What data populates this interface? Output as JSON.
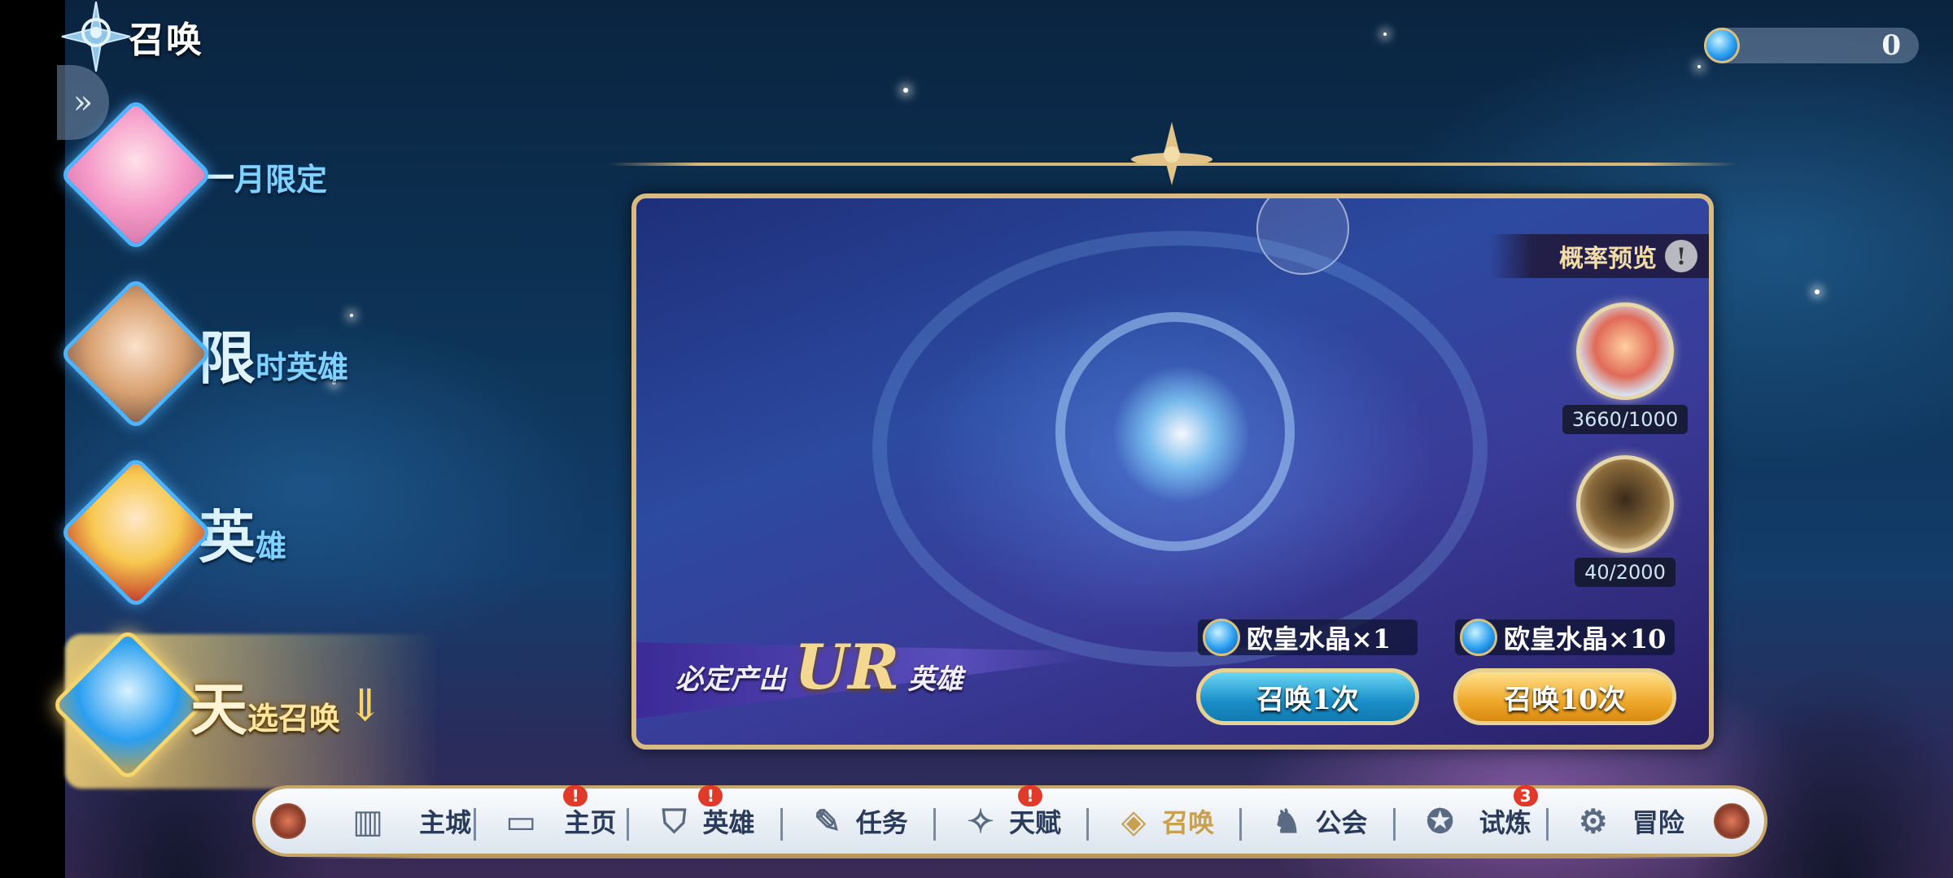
{
  "header": {
    "title": "召唤"
  },
  "currency": {
    "value": "0",
    "icon": "blue-crystal-gem"
  },
  "banners": [
    {
      "big": "一",
      "small": "月限定",
      "active": false
    },
    {
      "big": "限",
      "small": "时英雄",
      "active": false
    },
    {
      "big": "英",
      "small": "雄",
      "active": false
    },
    {
      "big": "天",
      "small": "选召唤",
      "active": true
    }
  ],
  "panel": {
    "probability_label": "概率预览",
    "rewards": [
      {
        "progress": "3660/1000",
        "icon": "treasure-chest"
      },
      {
        "progress": "40/2000",
        "icon": "hero-silhouette"
      }
    ],
    "ur": {
      "prefix": "必定产出",
      "highlight": "UR",
      "suffix": "英雄"
    },
    "summons": [
      {
        "cost": "欧皇水晶×1",
        "button": "召唤1次",
        "color": "#1a8ec8"
      },
      {
        "cost": "欧皇水晶×10",
        "button": "召唤10次",
        "color": "#f0a82a"
      }
    ]
  },
  "nav": {
    "items": [
      {
        "label": "主城",
        "icon": "castle-gate",
        "badge": ""
      },
      {
        "label": "主页",
        "icon": "banner-frame",
        "badge": "!"
      },
      {
        "label": "英雄",
        "icon": "helmet",
        "badge": "!"
      },
      {
        "label": "任务",
        "icon": "scroll-feather",
        "badge": ""
      },
      {
        "label": "天赋",
        "icon": "talent-star",
        "badge": "!"
      },
      {
        "label": "召唤",
        "icon": "summon-diamond",
        "badge": ""
      },
      {
        "label": "公会",
        "icon": "guild-knight",
        "badge": ""
      },
      {
        "label": "试炼",
        "icon": "trial-crest",
        "badge": "3"
      },
      {
        "label": "冒险",
        "icon": "gear-swirl",
        "badge": ""
      }
    ],
    "active_index": 5
  }
}
